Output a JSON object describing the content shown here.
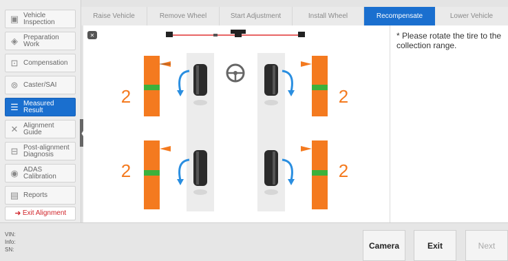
{
  "sidebar": {
    "items": [
      {
        "label": "Vehicle Inspection",
        "icon": "vehicle-inspection-icon",
        "active": false
      },
      {
        "label": "Preparation Work",
        "icon": "preparation-icon",
        "active": false
      },
      {
        "label": "Compensation",
        "icon": "compensation-icon",
        "active": false
      },
      {
        "label": "Caster/SAI",
        "icon": "caster-icon",
        "active": false
      },
      {
        "label": "Measured Result",
        "icon": "measured-result-icon",
        "active": true
      },
      {
        "label": "Alignment Guide",
        "icon": "wrench-icon",
        "active": false
      },
      {
        "label": "Post-alignment Diagnosis",
        "icon": "car-icon",
        "active": false
      },
      {
        "label": "ADAS Calibration",
        "icon": "adas-icon",
        "active": false
      },
      {
        "label": "Reports",
        "icon": "reports-icon",
        "active": false
      }
    ],
    "exit_label": "Exit Alignment"
  },
  "steps": [
    {
      "label": "Raise Vehicle",
      "active": false
    },
    {
      "label": "Remove Wheel",
      "active": false
    },
    {
      "label": "Start Adjustment",
      "active": false
    },
    {
      "label": "Install Wheel",
      "active": false
    },
    {
      "label": "Recompensate",
      "active": true
    },
    {
      "label": "Lower Vehicle",
      "active": false
    }
  ],
  "instruction": "* Please rotate the tire to the collection range.",
  "wheels": {
    "front_left": "2",
    "front_right": "2",
    "rear_left": "2",
    "rear_right": "2"
  },
  "footer": {
    "vin_label": "VIN:",
    "info_label": "Info:",
    "sn_label": "SN:",
    "camera": "Camera",
    "exit": "Exit",
    "next": "Next"
  },
  "colors": {
    "accent": "#1a6fcf",
    "orange": "#f47a1f",
    "green": "#3cb13c",
    "arrow": "#2a8ee0",
    "exit_red": "#d0242a"
  }
}
